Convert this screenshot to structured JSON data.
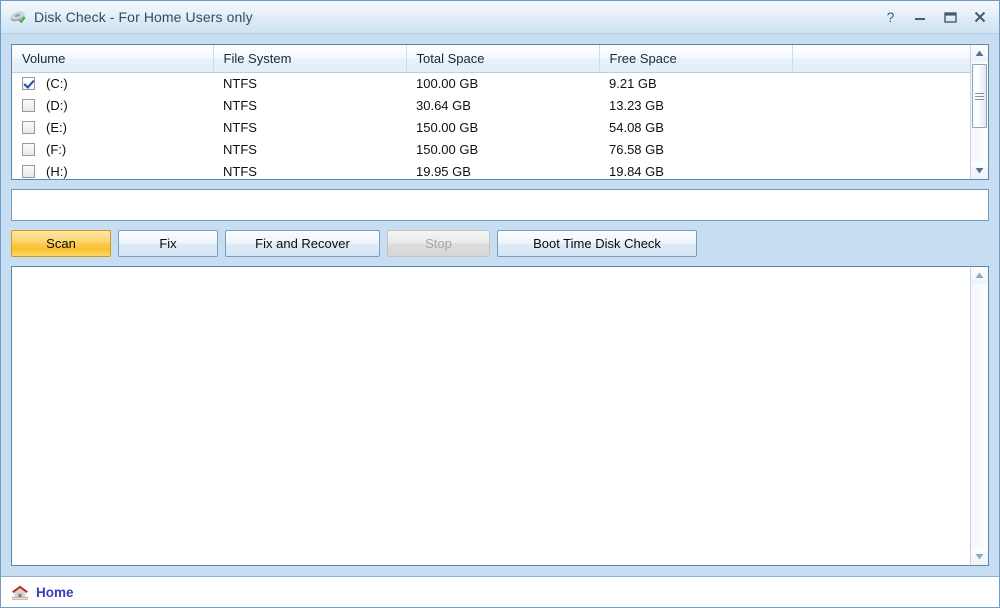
{
  "window": {
    "title": "Disk Check - For Home Users only",
    "app_icon": "disk-check-icon",
    "controls": [
      {
        "name": "help-button",
        "glyph": "?"
      },
      {
        "name": "minimize-button",
        "glyph": "–"
      },
      {
        "name": "maximize-button",
        "glyph": "❐"
      },
      {
        "name": "close-button",
        "glyph": "✕"
      }
    ]
  },
  "volume_table": {
    "columns": [
      "Volume",
      "File System",
      "Total Space",
      "Free Space",
      ""
    ],
    "rows": [
      {
        "checked": true,
        "volume": "(C:)",
        "file_system": "NTFS",
        "total_space": "100.00 GB",
        "free_space": "9.21 GB"
      },
      {
        "checked": false,
        "volume": "(D:)",
        "file_system": "NTFS",
        "total_space": "30.64 GB",
        "free_space": "13.23 GB"
      },
      {
        "checked": false,
        "volume": "(E:)",
        "file_system": "NTFS",
        "total_space": "150.00 GB",
        "free_space": "54.08 GB"
      },
      {
        "checked": false,
        "volume": "(F:)",
        "file_system": "NTFS",
        "total_space": "150.00 GB",
        "free_space": "76.58 GB"
      },
      {
        "checked": false,
        "volume": "(H:)",
        "file_system": "NTFS",
        "total_space": "19.95 GB",
        "free_space": "19.84 GB"
      }
    ]
  },
  "status_input": {
    "value": "",
    "placeholder": ""
  },
  "buttons": {
    "scan": "Scan",
    "fix": "Fix",
    "fix_and_recover": "Fix and Recover",
    "stop": "Stop",
    "boot_time_disk_check": "Boot Time Disk Check"
  },
  "log": {
    "text": ""
  },
  "footer": {
    "home_label": "Home",
    "home_icon": "house-icon"
  },
  "colors": {
    "window_background": "#c6ddf2",
    "titlebar_gradient_top": "#f2f7fc",
    "titlebar_gradient_bottom": "#d0e4f4",
    "panel_border": "#5b87ad",
    "primary_button": "#fbc94b",
    "primary_button_border": "#c9992b",
    "disabled_text": "#a6a6a6",
    "home_link_text": "#3c3cb4",
    "house_roof": "#b42d26"
  }
}
